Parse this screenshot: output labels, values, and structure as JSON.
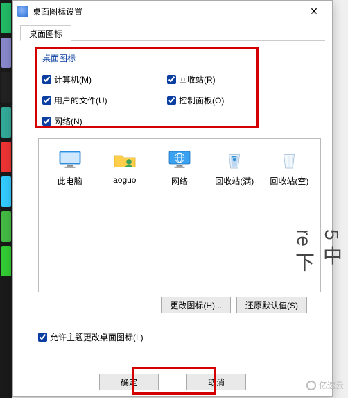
{
  "window": {
    "title": "桌面图标设置",
    "close_glyph": "✕"
  },
  "tab": {
    "label": "桌面图标"
  },
  "group": {
    "label": "桌面图标"
  },
  "checks": {
    "computer": {
      "label": "计算机(M)",
      "checked": true
    },
    "recycle": {
      "label": "回收站(R)",
      "checked": true
    },
    "userfiles": {
      "label": "用户的文件(U)",
      "checked": true
    },
    "cpanel": {
      "label": "控制面板(O)",
      "checked": true
    },
    "network": {
      "label": "网络(N)",
      "checked": true
    }
  },
  "icons": [
    {
      "id": "this-pc",
      "label": "此电脑",
      "kind": "monitor"
    },
    {
      "id": "user-folder",
      "label": "aoguo",
      "kind": "userfolder"
    },
    {
      "id": "network",
      "label": "网络",
      "kind": "netmonitor"
    },
    {
      "id": "recycle-full",
      "label": "回收站(满)",
      "kind": "bin-full"
    },
    {
      "id": "recycle-empty",
      "label": "回收站(空)",
      "kind": "bin-empty"
    }
  ],
  "buttons": {
    "change_icon": "更改图标(H)...",
    "restore_default": "还原默认值(S)",
    "allow_theme": "允许主题更改桌面图标(L)",
    "ok": "确定",
    "cancel": "取消"
  },
  "side_text": {
    "a": "5 中",
    "b": "re 下"
  },
  "watermark": "亿速云",
  "left_strip_colors": [
    "#2b6",
    "#88c",
    "#222",
    "#3a9",
    "#e33",
    "#3cf",
    "#4b4",
    "#3c3"
  ]
}
